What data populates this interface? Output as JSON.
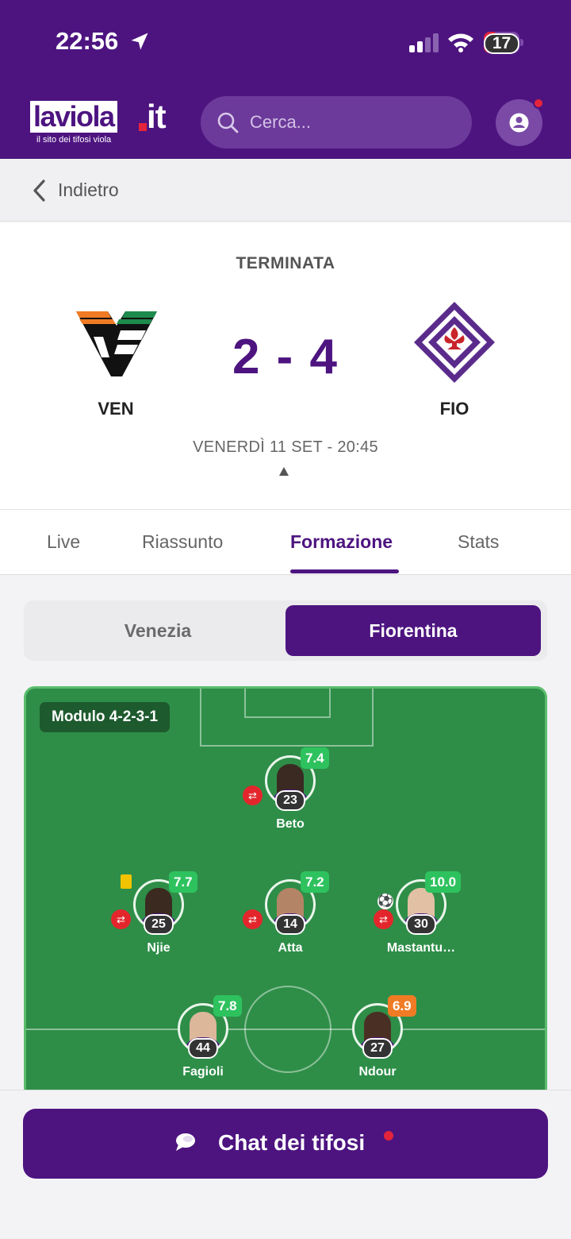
{
  "status_bar": {
    "time": "22:56",
    "battery": "17"
  },
  "brand": {
    "logo_main": "laviola",
    "logo_tld": "it",
    "tagline": "il sito dei tifosi viola"
  },
  "search": {
    "placeholder": "Cerca..."
  },
  "nav": {
    "back_label": "Indietro"
  },
  "match": {
    "status": "TERMINATA",
    "home": {
      "abbr": "VEN"
    },
    "away": {
      "abbr": "FIO"
    },
    "score": "2 - 4",
    "datetime": "VENERDÌ 11 SET - 20:45"
  },
  "tabs": [
    {
      "label": "Live",
      "active": false
    },
    {
      "label": "Riassunto",
      "active": false
    },
    {
      "label": "Formazione",
      "active": true
    },
    {
      "label": "Stats",
      "active": false
    }
  ],
  "team_toggle": {
    "home_label": "Venezia",
    "away_label": "Fiorentina",
    "selected": "Fiorentina"
  },
  "lineup": {
    "formation": "Modulo 4-2-3-1",
    "players": [
      {
        "name": "Beto",
        "number": "23",
        "rating": "7.4",
        "rating_color": "#2ec25f",
        "substituted": true
      },
      {
        "name": "Njie",
        "number": "25",
        "rating": "7.7",
        "rating_color": "#2ec25f",
        "substituted": true,
        "yellow_card": true
      },
      {
        "name": "Atta",
        "number": "14",
        "rating": "7.2",
        "rating_color": "#2ec25f",
        "substituted": true
      },
      {
        "name": "Mastantu…",
        "number": "30",
        "rating": "10.0",
        "rating_color": "#2ec25f",
        "substituted": true,
        "goal": true
      },
      {
        "name": "Fagioli",
        "number": "44",
        "rating": "7.8",
        "rating_color": "#2ec25f"
      },
      {
        "name": "Ndour",
        "number": "27",
        "rating": "6.9",
        "rating_color": "#f07b24"
      }
    ]
  },
  "chat": {
    "label": "Chat dei tifosi"
  },
  "colors": {
    "brand_purple": "#4d1480",
    "pitch_green": "#2e8e48",
    "alert_red": "#e4243b"
  }
}
